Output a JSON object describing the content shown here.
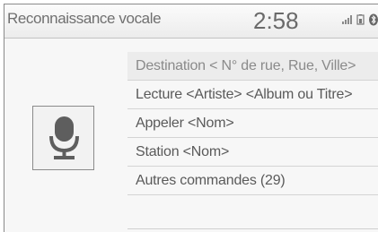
{
  "header": {
    "title": "Reconnaissance vocale",
    "clock": "2:58",
    "status_icons": [
      "signal-bars-icon",
      "phone-battery-icon",
      "bluetooth-icon"
    ]
  },
  "mic_button": {
    "icon": "microphone-icon"
  },
  "commands": [
    {
      "label": "Destination < N° de rue, Rue, Ville>"
    },
    {
      "label": "Lecture <Artiste> <Album ou Titre>"
    },
    {
      "label": "Appeler <Nom>"
    },
    {
      "label": "Station <Nom>"
    },
    {
      "label": "Autres commandes (29)"
    }
  ]
}
